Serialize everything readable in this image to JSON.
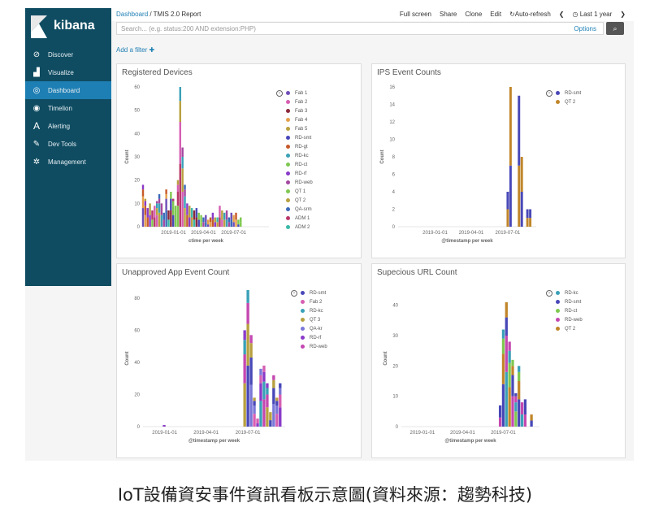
{
  "sidebar": {
    "logo_text": "kibana",
    "items": [
      {
        "label": "Discover",
        "icon": "compass-icon"
      },
      {
        "label": "Visualize",
        "icon": "bar-chart-icon"
      },
      {
        "label": "Dashboard",
        "icon": "dashboard-icon",
        "active": true
      },
      {
        "label": "Timelion",
        "icon": "timelion-icon"
      },
      {
        "label": "Alerting",
        "icon": "alerting-icon"
      },
      {
        "label": "Dev Tools",
        "icon": "wrench-icon"
      },
      {
        "label": "Management",
        "icon": "gear-icon"
      }
    ]
  },
  "topbar": {
    "breadcrumb_root": "Dashboard",
    "breadcrumb_sep": " / ",
    "breadcrumb_current": "TMIS 2.0 Report",
    "actions": [
      "Full screen",
      "Share",
      "Clone",
      "Edit",
      "Auto-refresh"
    ],
    "time_range": "Last 1 year"
  },
  "search": {
    "placeholder": "Search... (e.g. status:200 AND extension:PHP)",
    "options_label": "Options"
  },
  "add_filter": "Add a filter",
  "colors": {
    "sidebar_bg": "#0f4c62",
    "active": "#1e7fb4",
    "link": "#1e7fb4"
  },
  "chart_data": [
    {
      "type": "bar",
      "title": "Registered Devices",
      "ylabel": "Count",
      "xlabel": "ctime per week",
      "ylim": [
        0,
        60
      ],
      "yticks": [
        0,
        10,
        20,
        30,
        40,
        50,
        60
      ],
      "xticks": [
        "2019-01-01",
        "2019-04-01",
        "2019-07-01"
      ],
      "legend": [
        "Fab 1",
        "Fab 2",
        "Fab 3",
        "Fab 4",
        "Fab 5",
        "RD-smt",
        "RD-gt",
        "RD-kc",
        "RD-ct",
        "RD-rf",
        "RD-web",
        "QT 1",
        "QT 2",
        "QA-srm",
        "ADM 1",
        "ADM 2"
      ],
      "legend_colors": [
        "#6f4fb8",
        "#d65fb2",
        "#8a2a3a",
        "#e6a04a",
        "#b9a040",
        "#4848b8",
        "#c75a2a",
        "#3aa0b8",
        "#7ec850",
        "#8a3ac8",
        "#a448a0",
        "#7ec850",
        "#b8a040",
        "#3a6ab8",
        "#b8386a",
        "#3ab8a8"
      ],
      "values": [
        18,
        12,
        8,
        10,
        7,
        9,
        11,
        14,
        10,
        6,
        16,
        7,
        15,
        12,
        9,
        20,
        60,
        34,
        18,
        10,
        9,
        8,
        7,
        8,
        6,
        5,
        4,
        5,
        3,
        4,
        6,
        4,
        4,
        9,
        7,
        6,
        7,
        4,
        6,
        5,
        6,
        3,
        4
      ],
      "x_start": "2018-10-01",
      "x_step_days": 7
    },
    {
      "type": "bar",
      "title": "IPS Event Counts",
      "ylabel": "Count",
      "xlabel": "@timestamp per week",
      "ylim": [
        0,
        16
      ],
      "yticks": [
        0,
        2,
        4,
        6,
        8,
        10,
        12,
        14,
        16
      ],
      "xticks": [
        "2019-01-01",
        "2019-04-01",
        "2019-07-01"
      ],
      "legend": [
        "RD-smt",
        "QT 2"
      ],
      "legend_colors": [
        "#4848b8",
        "#c0862a"
      ],
      "points": [
        {
          "x": "2019-07-01",
          "y": 4
        },
        {
          "x": "2019-07-08",
          "y": 16
        },
        {
          "x": "2019-07-29",
          "y": 15
        },
        {
          "x": "2019-08-05",
          "y": 8
        },
        {
          "x": "2019-08-19",
          "y": 2
        },
        {
          "x": "2019-08-26",
          "y": 2
        }
      ]
    },
    {
      "type": "bar",
      "title": "Unapproved App Event Count",
      "ylabel": "Count",
      "xlabel": "@timestamp per week",
      "ylim": [
        0,
        85
      ],
      "yticks": [
        0,
        20,
        40,
        60,
        80
      ],
      "xticks": [
        "2019-01-01",
        "2019-04-01",
        "2019-07-01"
      ],
      "legend": [
        "RD-smt",
        "Fab 2",
        "RD-kc",
        "QT 3",
        "QA-kr",
        "RD-rf",
        "RD-web"
      ],
      "legend_colors": [
        "#4848b8",
        "#d65fb2",
        "#3aa0b8",
        "#b8a040",
        "#7a78d8",
        "#8a3ac8",
        "#c448b0"
      ],
      "points": [
        {
          "x": "2018-12-31",
          "y": 1
        },
        {
          "x": "2019-06-24",
          "y": 60
        },
        {
          "x": "2019-07-01",
          "y": 85
        },
        {
          "x": "2019-07-08",
          "y": 57
        },
        {
          "x": "2019-07-15",
          "y": 18
        },
        {
          "x": "2019-07-22",
          "y": 5
        },
        {
          "x": "2019-07-29",
          "y": 36
        },
        {
          "x": "2019-08-05",
          "y": 38
        },
        {
          "x": "2019-08-12",
          "y": 27
        },
        {
          "x": "2019-08-19",
          "y": 9
        },
        {
          "x": "2019-08-26",
          "y": 32
        },
        {
          "x": "2019-09-02",
          "y": 18
        },
        {
          "x": "2019-09-09",
          "y": 27
        }
      ]
    },
    {
      "type": "bar",
      "title": "Supecious URL Count",
      "ylabel": "Count",
      "xlabel": "@timestamp per week",
      "ylim": [
        0,
        45
      ],
      "yticks": [
        0,
        10,
        20,
        30,
        40
      ],
      "xticks": [
        "2019-01-01",
        "2019-04-01",
        "2019-07-01"
      ],
      "legend": [
        "RD-kc",
        "RD-smt",
        "RD-ct",
        "RD-web",
        "QT 2"
      ],
      "legend_colors": [
        "#3aa0b8",
        "#4848b8",
        "#7ec850",
        "#c448b0",
        "#c0862a"
      ],
      "points": [
        {
          "x": "2019-06-24",
          "y": 7
        },
        {
          "x": "2019-07-01",
          "y": 32
        },
        {
          "x": "2019-07-08",
          "y": 41
        },
        {
          "x": "2019-07-15",
          "y": 28
        },
        {
          "x": "2019-07-22",
          "y": 22
        },
        {
          "x": "2019-07-29",
          "y": 11
        },
        {
          "x": "2019-08-05",
          "y": 20
        },
        {
          "x": "2019-08-12",
          "y": 8
        },
        {
          "x": "2019-08-19",
          "y": 9
        },
        {
          "x": "2019-09-02",
          "y": 4
        }
      ]
    }
  ],
  "caption": "IoT設備資安事件資訊看板示意圖(資料來源：趨勢科技)"
}
